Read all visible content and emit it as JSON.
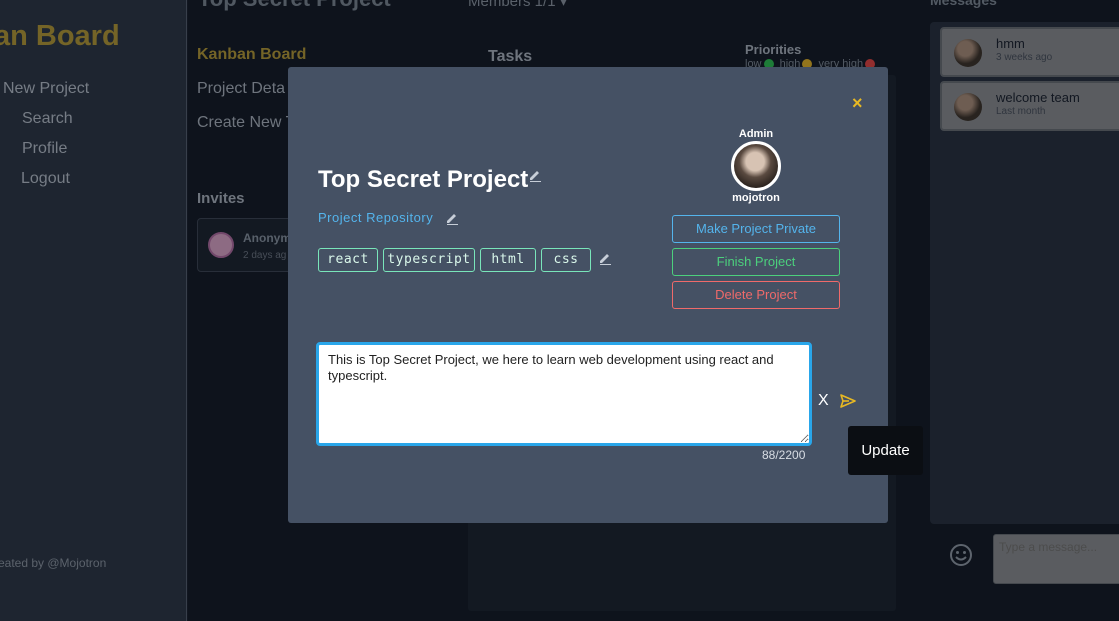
{
  "sidebar": {
    "brand": "an Board",
    "links": [
      "New Project",
      "Search",
      "Profile",
      "Logout"
    ],
    "footer": "eated by @Mojotron"
  },
  "project_nav": {
    "page_title": "Top Secret Project",
    "links": [
      "Kanban Board",
      "Project Deta",
      "Create New T"
    ],
    "invites_heading": "Invites",
    "invite": {
      "name": "Anonym",
      "time": "2 days ag"
    }
  },
  "board": {
    "members_label": "Members 1/1 ▾",
    "tasks_heading": "Tasks",
    "priorities_heading": "Priorities",
    "priorities": [
      {
        "label": "low",
        "color": "#2fbf56"
      },
      {
        "label": "high",
        "color": "#e0b22b"
      },
      {
        "label": "very high",
        "color": "#e04747"
      }
    ]
  },
  "messages": {
    "heading": "Messages",
    "items": [
      {
        "text": "hmm",
        "time": "3 weeks ago"
      },
      {
        "text": "welcome team",
        "time": "Last month"
      }
    ],
    "input_placeholder": "Type a message..."
  },
  "modal": {
    "close_label": "×",
    "role": "Admin",
    "owner_name": "mojotron",
    "title": "Top Secret Project",
    "repo_link": "Project Repository",
    "tags": [
      "react",
      "typescript",
      "html",
      "css"
    ],
    "buttons": {
      "make_private": "Make Project Private",
      "finish": "Finish Project",
      "delete": "Delete Project"
    },
    "description": "This is Top Secret Project, we here to learn web development using react and typescript.",
    "cancel_label": "X",
    "counter": "88/2200"
  },
  "tooltip": {
    "text": "Update"
  },
  "colors": {
    "accent_gold": "#b39a3c",
    "modal_bg": "#455164",
    "link_blue": "#54b4ec",
    "tag_green": "#79e6ba",
    "finish_green": "#4cd07d",
    "delete_red": "#ef6a6a",
    "close_yellow": "#e8b923"
  }
}
